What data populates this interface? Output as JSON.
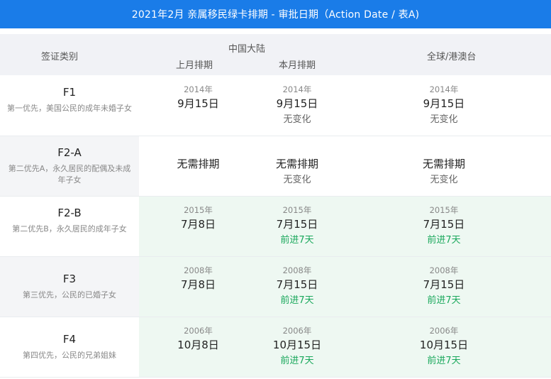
{
  "title": "2021年2月 亲属移民绿卡排期 - 审批日期（Action Date / 表A)",
  "header": {
    "category": "签证类别",
    "china_group": "中国大陆",
    "last_month": "上月排期",
    "this_month": "本月排期",
    "global": "全球/港澳台"
  },
  "colors": {
    "title_bar": "#1a7ce8",
    "advance_green": "#1aa85c",
    "highlight_bg": "#eef8f2"
  },
  "rows": [
    {
      "code": "F1",
      "desc": "第一优先，美国公民的成年未婚子女",
      "last": {
        "year": "2014年",
        "date": "9月15日"
      },
      "cur": {
        "year": "2014年",
        "date": "9月15日",
        "status": "无变化"
      },
      "global": {
        "year": "2014年",
        "date": "9月15日",
        "status": "无变化"
      }
    },
    {
      "code": "F2-A",
      "desc": "第二优先A，永久居民的配偶及未成年子女",
      "last": {
        "year": "",
        "date": "无需排期"
      },
      "cur": {
        "year": "",
        "date": "无需排期",
        "status": "无变化"
      },
      "global": {
        "year": "",
        "date": "无需排期",
        "status": "无变化"
      }
    },
    {
      "code": "F2-B",
      "desc": "第二优先B，永久居民的成年子女",
      "last": {
        "year": "2015年",
        "date": "7月8日"
      },
      "cur": {
        "year": "2015年",
        "date": "7月15日",
        "status": "前进7天"
      },
      "global": {
        "year": "2015年",
        "date": "7月15日",
        "status": "前进7天"
      }
    },
    {
      "code": "F3",
      "desc": "第三优先，公民的已婚子女",
      "last": {
        "year": "2008年",
        "date": "7月8日"
      },
      "cur": {
        "year": "2008年",
        "date": "7月15日",
        "status": "前进7天"
      },
      "global": {
        "year": "2008年",
        "date": "7月15日",
        "status": "前进7天"
      }
    },
    {
      "code": "F4",
      "desc": "第四优先，公民的兄弟姐妹",
      "last": {
        "year": "2006年",
        "date": "10月8日"
      },
      "cur": {
        "year": "2006年",
        "date": "10月15日",
        "status": "前进7天"
      },
      "global": {
        "year": "2006年",
        "date": "10月15日",
        "status": "前进7天"
      }
    }
  ]
}
